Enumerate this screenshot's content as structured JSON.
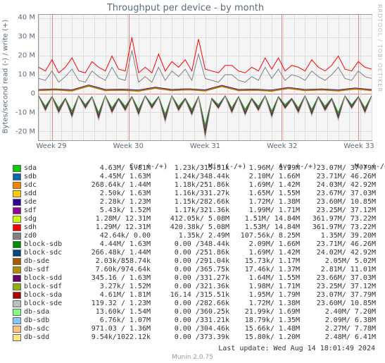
{
  "title": "Throughput per device - by month",
  "ylabel": "Bytes/second read (-) / write (+)",
  "watermark": "RRDTOOL / TOBI OETIKER",
  "generator": "Munin 2.0.75",
  "last_update": "Last update: Wed Aug 14 18:01:49 2024",
  "legend_headers": {
    "name": "",
    "cur": "Cur (-/+)",
    "min": "Min (-/+)",
    "avg": "Avg (-/+)",
    "max": "Max (-/+)"
  },
  "chart_data": {
    "type": "line",
    "x_ticks": [
      "Week 29",
      "Week 30",
      "Week 31",
      "Week 32",
      "Week 33"
    ],
    "y_ticks": [
      "-20 M",
      "-10 M",
      "0",
      "10 M",
      "20 M",
      "30 M",
      "40 M"
    ],
    "ylim": [
      -25,
      42
    ],
    "series": [
      {
        "name": "sda",
        "color": "#00cc00",
        "cur": "4.63M/  1.81M",
        "min": "1.23k/315.51k",
        "avg": "1.96M/  1.79M",
        "max": "23.07M/ 37.79M"
      },
      {
        "name": "sdb",
        "color": "#0066b3",
        "cur": "4.45M/  1.63M",
        "min": "1.24k/348.44k",
        "avg": "2.10M/  1.66M",
        "max": "23.71M/ 46.26M"
      },
      {
        "name": "sdc",
        "color": "#ff8000",
        "cur": "268.64k/  1.44M",
        "min": "1.18k/251.86k",
        "avg": "1.69M/  1.42M",
        "max": "24.03M/ 42.92M"
      },
      {
        "name": "sdd",
        "color": "#ffcc00",
        "cur": "2.50k/  1.63M",
        "min": "1.16k/331.27k",
        "avg": "1.65M/  1.55M",
        "max": "23.67M/ 37.03M"
      },
      {
        "name": "sde",
        "color": "#330099",
        "cur": "2.28k/  1.23M",
        "min": "1.15k/282.66k",
        "avg": "1.72M/  1.38M",
        "max": "23.60M/ 10.85M"
      },
      {
        "name": "sdf",
        "color": "#990099",
        "cur": "5.43k/  1.52M",
        "min": "1.17k/321.36k",
        "avg": "1.99M/  1.71M",
        "max": "23.25M/ 37.12M"
      },
      {
        "name": "sdg",
        "color": "#ccff00",
        "cur": "1.28M/ 12.31M",
        "min": "412.05k/  5.08M",
        "avg": "1.51M/ 14.84M",
        "max": "361.97M/ 73.22M"
      },
      {
        "name": "sdh",
        "color": "#ff0000",
        "cur": "1.29M/ 12.31M",
        "min": "420.38k/  5.08M",
        "avg": "1.53M/ 14.84M",
        "max": "361.97M/ 73.22M"
      },
      {
        "name": "zd0",
        "color": "#808080",
        "cur": "42.64k/   0.00 ",
        "min": "1.35k/  2.49M",
        "avg": "107.56k/  8.25M",
        "max": "1.35M/ 39.20M"
      },
      {
        "name": "block-sdb",
        "color": "#008f00",
        "cur": "4.44M/  1.63M",
        "min": "0.00 /348.44k",
        "avg": "2.09M/  1.66M",
        "max": "23.71M/ 46.26M"
      },
      {
        "name": "block-sdc",
        "color": "#00487d",
        "cur": "266.48k/  1.44M",
        "min": "0.00 /251.86k",
        "avg": "1.69M/  1.42M",
        "max": "24.02M/ 42.92M"
      },
      {
        "name": "db-sde",
        "color": "#b35a00",
        "cur": "2.03k/858.74k",
        "min": "0.00 /291.04k",
        "avg": "15.73k/  1.17M",
        "max": "2.05M/  5.02M"
      },
      {
        "name": "db-sdf",
        "color": "#b38f00",
        "cur": "7.60k/974.64k",
        "min": "0.00 /365.75k",
        "avg": "17.46k/  1.37M",
        "max": "2.81M/ 11.01M"
      },
      {
        "name": "block-sdd",
        "color": "#6b006b",
        "cur": "345.16 /  1.63M",
        "min": "0.00 /331.27k",
        "avg": "1.64M/  1.55M",
        "max": "23.66M/ 37.03M"
      },
      {
        "name": "block-sdf",
        "color": "#8fb300",
        "cur": "3.27k/  1.52M",
        "min": "0.00 /321.36k",
        "avg": "1.98M/  1.71M",
        "max": "23.25M/ 37.12M"
      },
      {
        "name": "block-sda",
        "color": "#b30000",
        "cur": "4.61M/  1.81M",
        "min": "16.14 /315.51k",
        "avg": "1.95M/  1.79M",
        "max": "23.07M/ 37.79M"
      },
      {
        "name": "block-sde",
        "color": "#bebebe",
        "cur": "119.32 /  1.23M",
        "min": "0.00 /282.66k",
        "avg": "1.72M/  1.38M",
        "max": "23.60M/ 10.85M"
      },
      {
        "name": "db-sda",
        "color": "#80ff80",
        "cur": "13.60k/  1.54M",
        "min": "0.00 /360.25k",
        "avg": "21.99k/  1.69M",
        "max": "2.40M/  7.20M"
      },
      {
        "name": "db-sdb",
        "color": "#80c9ff",
        "cur": "6.76k/  1.07M",
        "min": "0.00 /331.21k",
        "avg": "18.79k/  1.35M",
        "max": "2.09M/  6.38M"
      },
      {
        "name": "db-sdc",
        "color": "#ffc080",
        "cur": "971.03 /  1.36M",
        "min": "0.00 /304.46k",
        "avg": "15.66k/  1.48M",
        "max": "2.27M/  7.78M"
      },
      {
        "name": "db-sdd",
        "color": "#ffe680",
        "cur": "9.54k/1022.12k",
        "min": "0.00 /373.39k",
        "avg": "15.80k/  1.20M",
        "max": "2.48M/  6.41M"
      }
    ],
    "sample_traces": {
      "sdh_write": [
        [
          0,
          14
        ],
        [
          2,
          12
        ],
        [
          4,
          18
        ],
        [
          6,
          11
        ],
        [
          8,
          14
        ],
        [
          10,
          19
        ],
        [
          12,
          12
        ],
        [
          14,
          11
        ],
        [
          16,
          17
        ],
        [
          18,
          14
        ],
        [
          20,
          12
        ],
        [
          22,
          20
        ],
        [
          24,
          13
        ],
        [
          26,
          12
        ],
        [
          28,
          30
        ],
        [
          30,
          11
        ],
        [
          32,
          14
        ],
        [
          34,
          11
        ],
        [
          36,
          21
        ],
        [
          38,
          12
        ],
        [
          40,
          17
        ],
        [
          42,
          14
        ],
        [
          44,
          18
        ],
        [
          46,
          12
        ],
        [
          48,
          29
        ],
        [
          50,
          13
        ],
        [
          52,
          12
        ],
        [
          54,
          11
        ],
        [
          56,
          15
        ],
        [
          58,
          15
        ],
        [
          60,
          12
        ],
        [
          62,
          11
        ],
        [
          64,
          14
        ],
        [
          66,
          12
        ],
        [
          68,
          19
        ],
        [
          70,
          13
        ],
        [
          72,
          19
        ],
        [
          74,
          12
        ],
        [
          76,
          15
        ],
        [
          78,
          14
        ],
        [
          80,
          12
        ],
        [
          82,
          18
        ],
        [
          84,
          14
        ],
        [
          86,
          12
        ],
        [
          88,
          15
        ],
        [
          90,
          20
        ],
        [
          92,
          13
        ],
        [
          94,
          12
        ],
        [
          96,
          17
        ],
        [
          98,
          14
        ],
        [
          100,
          13
        ]
      ],
      "sdg_write": [
        [
          0,
          8
        ],
        [
          2,
          7
        ],
        [
          4,
          12
        ],
        [
          6,
          6
        ],
        [
          8,
          9
        ],
        [
          10,
          13
        ],
        [
          12,
          7
        ],
        [
          14,
          6
        ],
        [
          16,
          12
        ],
        [
          18,
          9
        ],
        [
          20,
          7
        ],
        [
          22,
          14
        ],
        [
          24,
          8
        ],
        [
          26,
          7
        ],
        [
          28,
          23
        ],
        [
          30,
          6
        ],
        [
          32,
          9
        ],
        [
          34,
          6
        ],
        [
          36,
          14
        ],
        [
          38,
          7
        ],
        [
          40,
          12
        ],
        [
          42,
          9
        ],
        [
          44,
          13
        ],
        [
          46,
          7
        ],
        [
          48,
          21
        ],
        [
          50,
          8
        ],
        [
          52,
          7
        ],
        [
          54,
          6
        ],
        [
          56,
          10
        ],
        [
          58,
          10
        ],
        [
          60,
          7
        ],
        [
          62,
          6
        ],
        [
          64,
          9
        ],
        [
          66,
          7
        ],
        [
          68,
          14
        ],
        [
          70,
          8
        ],
        [
          72,
          13
        ],
        [
          74,
          7
        ],
        [
          76,
          10
        ],
        [
          78,
          9
        ],
        [
          80,
          7
        ],
        [
          82,
          12
        ],
        [
          84,
          9
        ],
        [
          86,
          7
        ],
        [
          88,
          10
        ],
        [
          90,
          14
        ],
        [
          92,
          8
        ],
        [
          94,
          7
        ],
        [
          96,
          12
        ],
        [
          98,
          9
        ],
        [
          100,
          8
        ]
      ],
      "cluster_write": [
        [
          0,
          1.8
        ],
        [
          5,
          2.1
        ],
        [
          10,
          1.6
        ],
        [
          15,
          4.2
        ],
        [
          20,
          1.8
        ],
        [
          25,
          2.0
        ],
        [
          30,
          1.5
        ],
        [
          35,
          3.0
        ],
        [
          40,
          1.8
        ],
        [
          45,
          2.2
        ],
        [
          50,
          1.6
        ],
        [
          55,
          4.0
        ],
        [
          60,
          1.8
        ],
        [
          65,
          2.0
        ],
        [
          70,
          1.5
        ],
        [
          75,
          2.9
        ],
        [
          80,
          1.8
        ],
        [
          85,
          2.1
        ],
        [
          90,
          1.6
        ],
        [
          95,
          2.6
        ],
        [
          100,
          1.8
        ]
      ],
      "cluster_read": [
        [
          0,
          -1.5
        ],
        [
          2,
          -8
        ],
        [
          4,
          -2
        ],
        [
          6,
          -9
        ],
        [
          8,
          -3
        ],
        [
          10,
          -11
        ],
        [
          12,
          -1.5
        ],
        [
          14,
          -7
        ],
        [
          16,
          -2
        ],
        [
          18,
          -12
        ],
        [
          20,
          -1.5
        ],
        [
          22,
          -9
        ],
        [
          24,
          -3
        ],
        [
          26,
          -8
        ],
        [
          28,
          -2
        ],
        [
          30,
          -10
        ],
        [
          32,
          -1.5
        ],
        [
          34,
          -7
        ],
        [
          36,
          -2
        ],
        [
          38,
          -13
        ],
        [
          40,
          -1.5
        ],
        [
          42,
          -8
        ],
        [
          44,
          -3
        ],
        [
          46,
          -10
        ],
        [
          48,
          -2
        ],
        [
          50,
          -20
        ],
        [
          52,
          -3
        ],
        [
          54,
          -7
        ],
        [
          56,
          -1.5
        ],
        [
          58,
          -9
        ],
        [
          60,
          -2
        ],
        [
          62,
          -10
        ],
        [
          64,
          -3
        ],
        [
          66,
          -8
        ],
        [
          68,
          -1.5
        ],
        [
          70,
          -11
        ],
        [
          72,
          -2
        ],
        [
          74,
          -7
        ],
        [
          76,
          -3
        ],
        [
          78,
          -9
        ],
        [
          80,
          -1.5
        ],
        [
          82,
          -10
        ],
        [
          84,
          -2
        ],
        [
          86,
          -8
        ],
        [
          88,
          -3
        ],
        [
          90,
          -12
        ],
        [
          92,
          -1.5
        ],
        [
          94,
          -7
        ],
        [
          96,
          -2
        ],
        [
          98,
          -9
        ],
        [
          100,
          -1.5
        ]
      ]
    }
  }
}
